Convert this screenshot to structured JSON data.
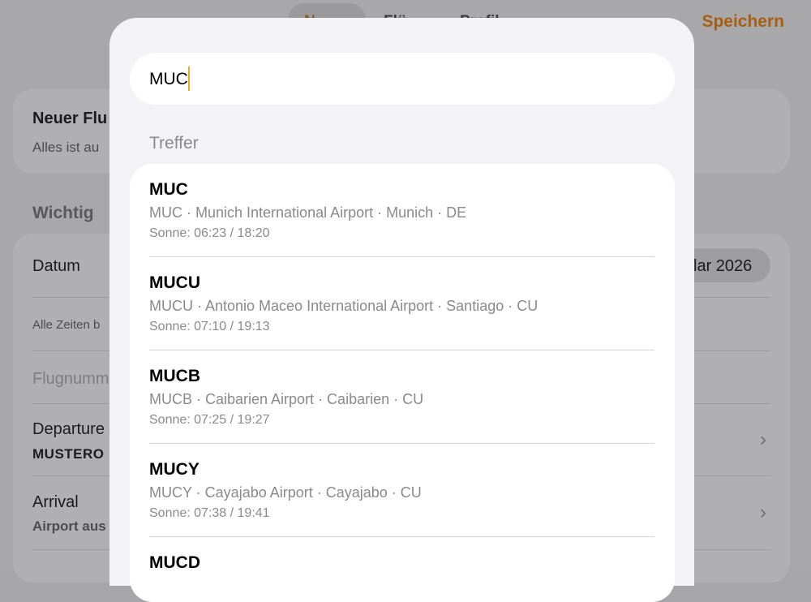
{
  "header": {
    "tabs": [
      {
        "label": "N",
        "active": true
      },
      {
        "label": "Flü",
        "active": false
      },
      {
        "label": "Profil",
        "active": false
      }
    ],
    "save_label": "Speichern"
  },
  "background": {
    "new_flight_title": "Neuer Flu",
    "new_flight_sub": "Alles ist au",
    "section_important": "Wichtig",
    "date_label": "Datum",
    "date_value": "lar 2026",
    "times_note": "Alle Zeiten b",
    "flight_number_placeholder": "Flugnumm",
    "departure_label": "Departure",
    "departure_value": "MUSTERO",
    "arrival_label": "Arrival",
    "arrival_value": "Airport aus"
  },
  "search": {
    "value": "MUC"
  },
  "results": {
    "section_title": "Treffer",
    "items": [
      {
        "code": "MUC",
        "name": "MUC · Munich International Airport · Munich · DE",
        "sun": "Sonne: 06:23 / 18:20"
      },
      {
        "code": "MUCU",
        "name": "MUCU · Antonio Maceo International Airport · Santiago · CU",
        "sun": "Sonne: 07:10 / 19:13"
      },
      {
        "code": "MUCB",
        "name": "MUCB · Caibarien Airport · Caibarien · CU",
        "sun": "Sonne: 07:25 / 19:27"
      },
      {
        "code": "MUCY",
        "name": "MUCY · Cayajabo Airport · Cayajabo · CU",
        "sun": "Sonne: 07:38 / 19:41"
      },
      {
        "code": "MUCD",
        "name": "",
        "sun": ""
      }
    ]
  },
  "colors": {
    "accent": "#a65f12",
    "caret": "#f0a81c"
  }
}
